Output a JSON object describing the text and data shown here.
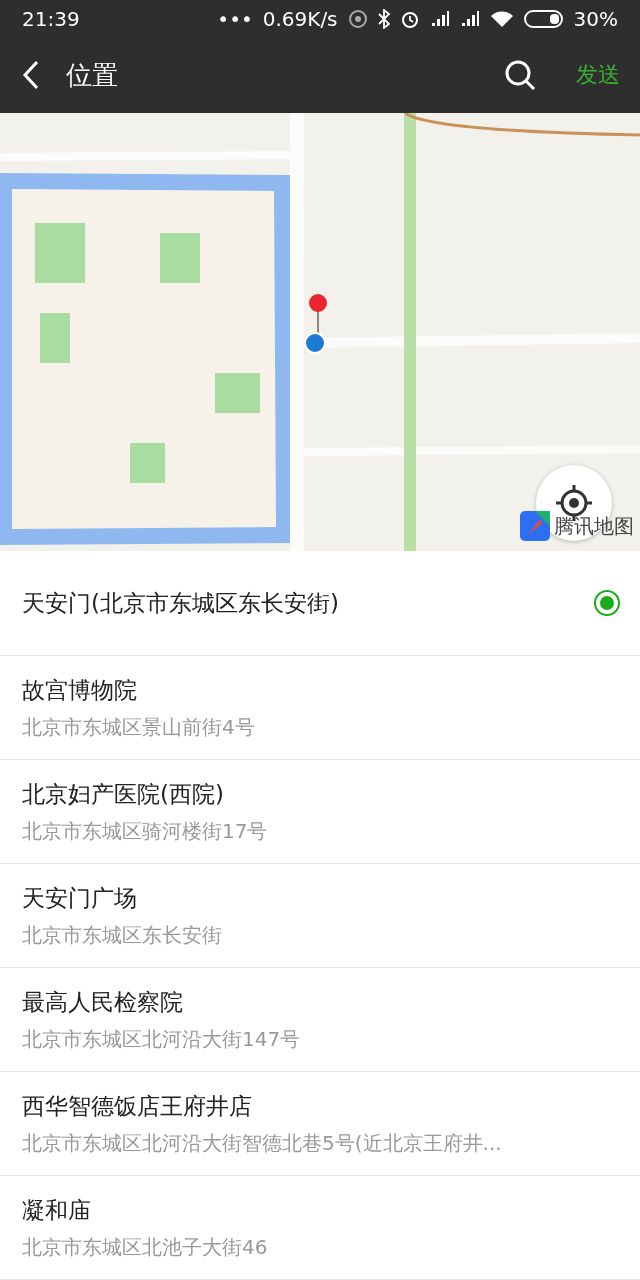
{
  "status_bar": {
    "time": "21:39",
    "dots": "•••",
    "speed": "0.69K/s",
    "battery": "30%"
  },
  "nav": {
    "title": "位置",
    "send": "发送"
  },
  "map": {
    "kind": "picture",
    "attribution": "腾讯地图"
  },
  "places": [
    {
      "name": "天安门(北京市东城区东长安街)",
      "selected": true
    },
    {
      "name": "故宫博物院",
      "address": "北京市东城区景山前街4号",
      "selected": false
    },
    {
      "name": "北京妇产医院(西院)",
      "address": "北京市东城区骑河楼街17号",
      "selected": false
    },
    {
      "name": "天安门广场",
      "address": "北京市东城区东长安街",
      "selected": false
    },
    {
      "name": "最高人民检察院",
      "address": "北京市东城区北河沿大街147号",
      "selected": false
    },
    {
      "name": "西华智德饭店王府井店",
      "address": "北京市东城区北河沿大街智德北巷5号(近北京王府井...",
      "selected": false
    },
    {
      "name": "凝和庙",
      "address": "北京市东城区北池子大街46",
      "selected": false
    }
  ]
}
